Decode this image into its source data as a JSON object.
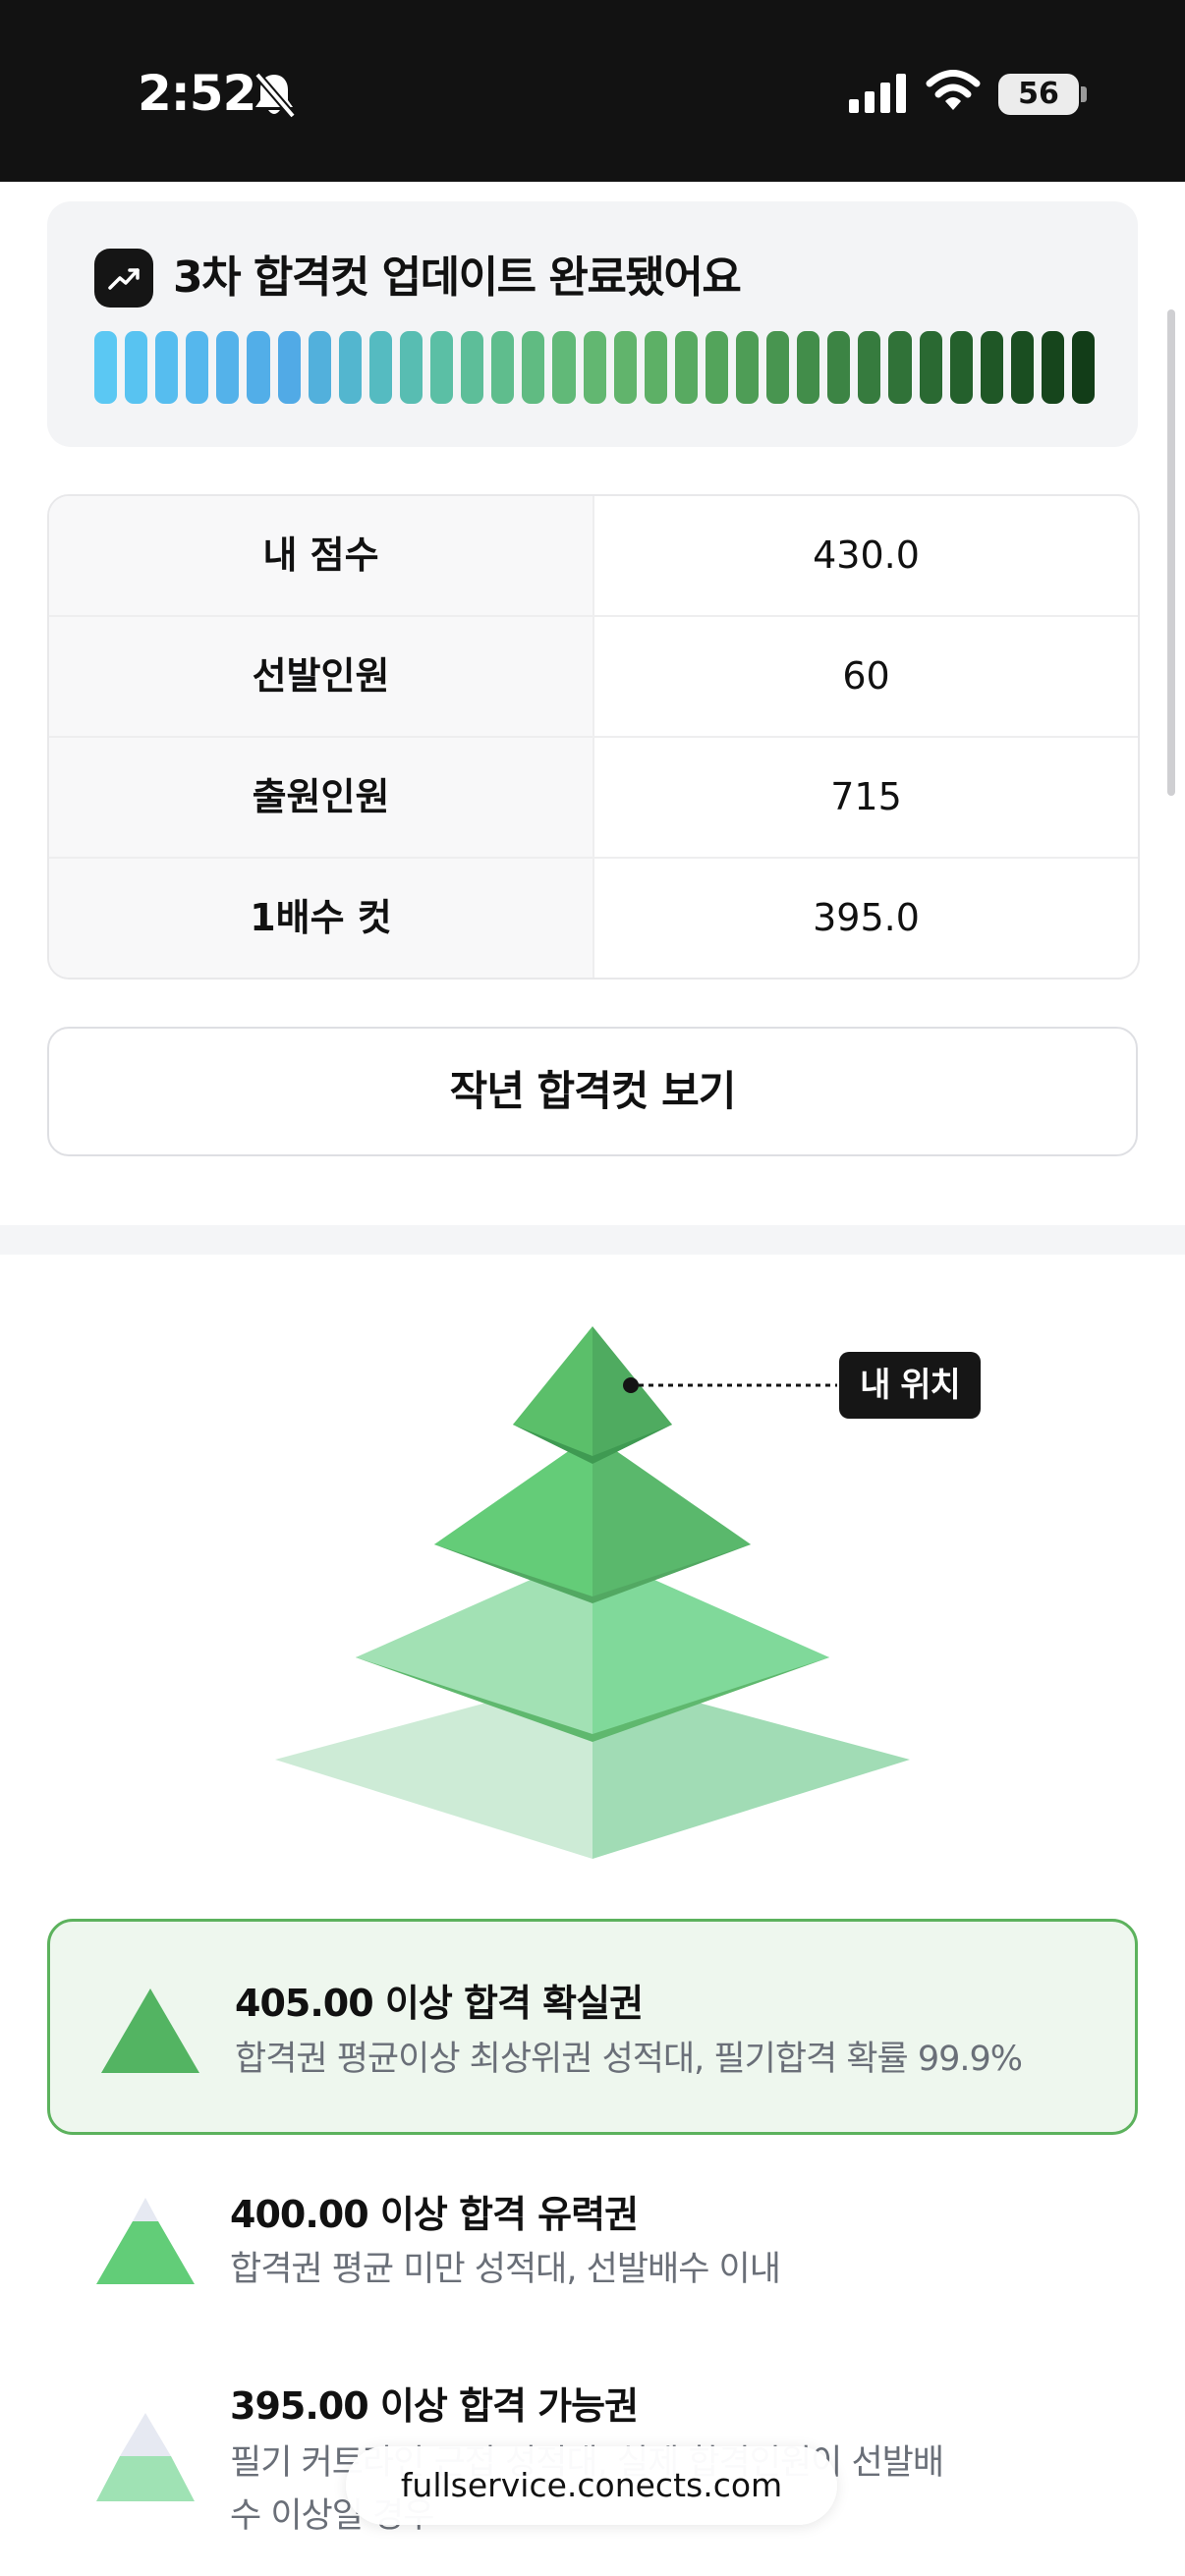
{
  "status_bar": {
    "time": "2:52",
    "battery": "56"
  },
  "banner": {
    "icon": "trend-up-icon",
    "title": "3차 합격컷 업데이트 완료됐어요",
    "colors": [
      "#5bc8f3",
      "#58c3f1",
      "#56bdef",
      "#55b7ed",
      "#54b2ea",
      "#52aee8",
      "#51aae6",
      "#52b0dc",
      "#53b6cf",
      "#55bbc1",
      "#58bdb2",
      "#5bbfa5",
      "#5dbe99",
      "#5fbd8d",
      "#60bb82",
      "#61b978",
      "#62b771",
      "#61b46c",
      "#5db066",
      "#58aa61",
      "#53a45b",
      "#4e9d56",
      "#489550",
      "#428d4a",
      "#3c8444",
      "#367b3e",
      "#307238",
      "#2a6932",
      "#24602c",
      "#1f5726",
      "#1a4e21",
      "#16451c",
      "#123d18"
    ]
  },
  "score_table": {
    "rows": [
      {
        "label": "내 점수",
        "value": "430.0"
      },
      {
        "label": "선발인원",
        "value": "60"
      },
      {
        "label": "출원인원",
        "value": "715"
      },
      {
        "label": "1배수 컷",
        "value": "395.0"
      }
    ]
  },
  "prev_year_button": "작년 합격컷 보기",
  "pyramid": {
    "my_position_label": "내 위치"
  },
  "tiers": [
    {
      "title": "405.00 이상 합격 확실권",
      "desc": "합격권 평균이상 최상위권 성적대, 필기합격 확률 99.9%",
      "color": "#53b462"
    },
    {
      "title": "400.00 이상 합격 유력권",
      "desc": "합격권 평균 미만 성적대, 선발배수 이내",
      "color": "#62cd78"
    },
    {
      "title": "395.00 이상 합격 가능권",
      "desc_line1": "필기 커트라인 근접 성적대, 실제 합격인원이 선발배",
      "desc_line2": "수 이상일 경우",
      "color": "#9fe2b4"
    }
  ],
  "browser": {
    "url": "fullservice.conects.com"
  }
}
